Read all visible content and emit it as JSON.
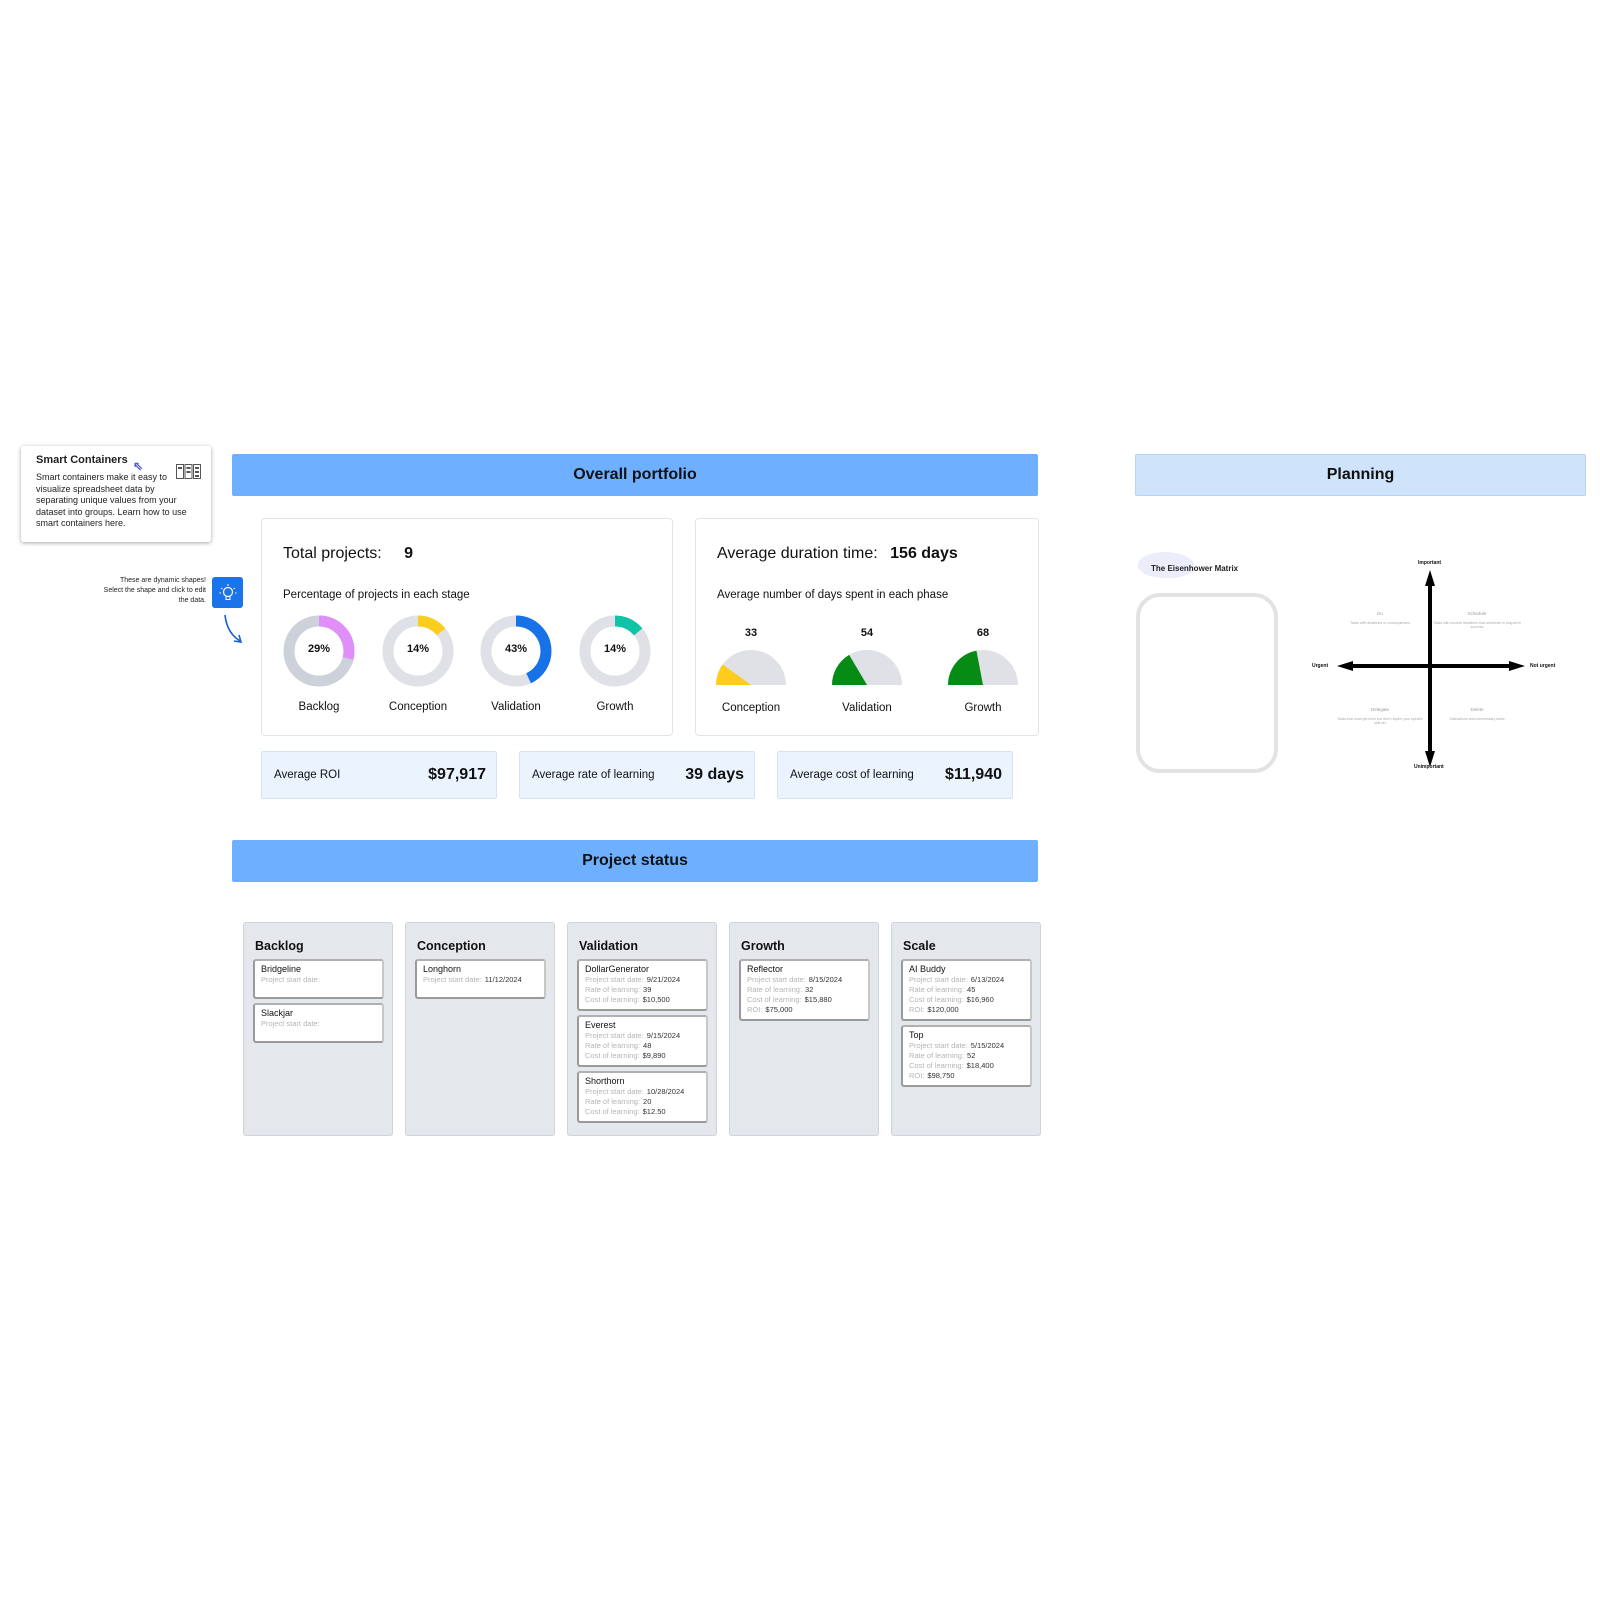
{
  "note": {
    "title": "Smart Containers",
    "body": "Smart containers make it easy to visualize spreadsheet data by separating unique values from your dataset into groups. Learn how to use smart containers here.",
    "cursor_icon": "cursor-icon",
    "grid_icon": "smart-container-icon"
  },
  "tip": {
    "text": "These are dynamic shapes! Select the shape and click to edit the data.",
    "icon": "lightbulb-icon"
  },
  "sections": {
    "overall": "Overall portfolio",
    "status": "Project status",
    "planning": "Planning"
  },
  "total": {
    "label": "Total projects:",
    "value": "9",
    "subtitle": "Percentage of projects in each stage",
    "stages": [
      {
        "label": "Backlog",
        "pct_text": "29%",
        "pct": 0.29,
        "color": "#e08ef8",
        "track": "#cdd1d9"
      },
      {
        "label": "Conception",
        "pct_text": "14%",
        "pct": 0.14,
        "color": "#fccd1d",
        "track": "#dfe1e6"
      },
      {
        "label": "Validation",
        "pct_text": "43%",
        "pct": 0.43,
        "color": "#1772e8",
        "track": "#dfe1e6"
      },
      {
        "label": "Growth",
        "pct_text": "14%",
        "pct": 0.14,
        "color": "#0ec3a6",
        "track": "#dfe1e6"
      }
    ]
  },
  "duration": {
    "label": "Average duration time:",
    "value": "156 days",
    "subtitle": "Average number of days spent in each phase",
    "phases": [
      {
        "label": "Conception",
        "value_text": "33",
        "fraction": 0.2,
        "color": "#fccd1d"
      },
      {
        "label": "Validation",
        "value_text": "54",
        "fraction": 0.33,
        "color": "#068b15"
      },
      {
        "label": "Growth",
        "value_text": "68",
        "fraction": 0.44,
        "color": "#068b15"
      }
    ],
    "track_color": "#dfe1e6"
  },
  "kpis": [
    {
      "label": "Average ROI",
      "value": "$97,917"
    },
    {
      "label": "Average rate of learning",
      "value": "39 days"
    },
    {
      "label": "Average cost of learning",
      "value": "$11,940"
    }
  ],
  "columns": [
    {
      "title": "Backlog",
      "cards": [
        {
          "name": "Bridgeline",
          "rows": [
            {
              "k": "Project start date:",
              "v": ""
            }
          ]
        },
        {
          "name": "Slackjar",
          "rows": [
            {
              "k": "Project start date:",
              "v": ""
            }
          ]
        }
      ]
    },
    {
      "title": "Conception",
      "cards": [
        {
          "name": "Longhorn",
          "rows": [
            {
              "k": "Project start date:",
              "v": "11/12/2024"
            }
          ]
        }
      ]
    },
    {
      "title": "Validation",
      "cards": [
        {
          "name": "DollarGenerator",
          "rows": [
            {
              "k": "Project start date:",
              "v": "9/21/2024"
            },
            {
              "k": "Rate of learning:",
              "v": "39"
            },
            {
              "k": "Cost of learning:",
              "v": "$10,500"
            }
          ]
        },
        {
          "name": "Everest",
          "rows": [
            {
              "k": "Project start date:",
              "v": "9/15/2024"
            },
            {
              "k": "Rate of learning:",
              "v": "48"
            },
            {
              "k": "Cost of learning:",
              "v": "$9,890"
            }
          ]
        },
        {
          "name": "Shorthorn",
          "rows": [
            {
              "k": "Project start date:",
              "v": "10/28/2024"
            },
            {
              "k": "Rate of learning:",
              "v": "20"
            },
            {
              "k": "Cost of learning:",
              "v": "$12.50"
            }
          ]
        }
      ]
    },
    {
      "title": "Growth",
      "cards": [
        {
          "name": "Reflector",
          "rows": [
            {
              "k": "Project start date:",
              "v": "8/15/2024"
            },
            {
              "k": "Rate of learning:",
              "v": "32"
            },
            {
              "k": "Cost of learning:",
              "v": "$15,880"
            },
            {
              "k": "ROI:",
              "v": "$75,000"
            }
          ]
        }
      ]
    },
    {
      "title": "Scale",
      "cards": [
        {
          "name": "AI Buddy",
          "rows": [
            {
              "k": "Project start date:",
              "v": "6/13/2024"
            },
            {
              "k": "Rate of learning:",
              "v": "45"
            },
            {
              "k": "Cost of learning:",
              "v": "$16,960"
            },
            {
              "k": "ROI:",
              "v": "$120,000"
            }
          ]
        },
        {
          "name": "Top",
          "rows": [
            {
              "k": "Project start date:",
              "v": "5/15/2024"
            },
            {
              "k": "Rate of learning:",
              "v": "52"
            },
            {
              "k": "Cost of learning:",
              "v": "$18,400"
            },
            {
              "k": "ROI:",
              "v": "$98,750"
            }
          ]
        }
      ]
    }
  ],
  "eisenhower": {
    "title": "The Eisenhower Matrix",
    "axes": {
      "top": "Important",
      "bottom": "Unimportant",
      "left": "Urgent",
      "right": "Not urgent"
    },
    "quadrants": [
      {
        "title": "Do",
        "desc": "Tasks with deadlines or consequences"
      },
      {
        "title": "Schedule",
        "desc": "Tasks with unclear deadlines that contribute to long-term success"
      },
      {
        "title": "Delegate",
        "desc": "Tasks that must get done but don't require your specific skill set"
      },
      {
        "title": "Delete",
        "desc": "Distractions and unnecessary tasks"
      }
    ]
  }
}
